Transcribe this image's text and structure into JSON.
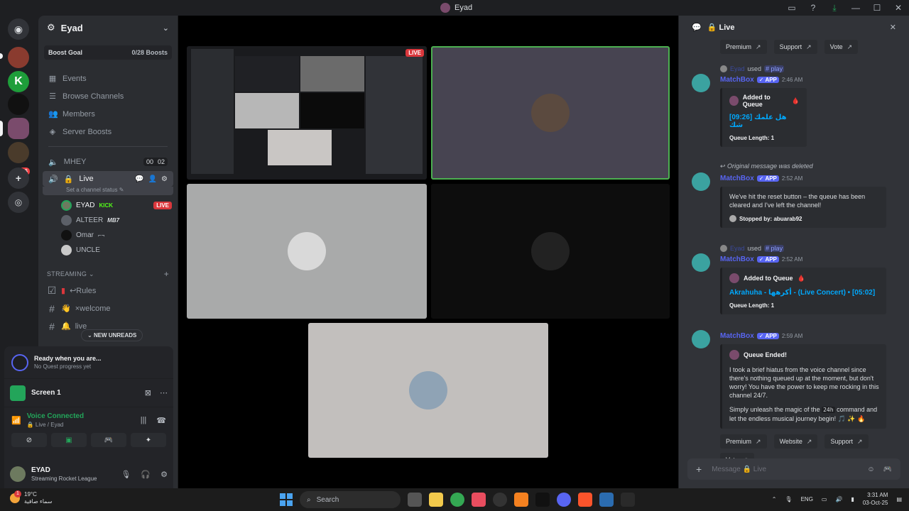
{
  "window": {
    "title": "Eyad"
  },
  "server": {
    "name": "Eyad",
    "boost_goal_label": "Boost Goal",
    "boost_count": "0/28 Boosts",
    "badge_count": "96"
  },
  "nav": [
    {
      "label": "Events",
      "icon": "calendar-icon"
    },
    {
      "label": "Browse Channels",
      "icon": "browse-icon"
    },
    {
      "label": "Members",
      "icon": "members-icon"
    },
    {
      "label": "Server Boosts",
      "icon": "boost-icon"
    }
  ],
  "voice_channels": {
    "mhey": {
      "name": "MHEY",
      "count_a": "00",
      "count_b": "02"
    },
    "live": {
      "name": "Live",
      "status": "Set a channel status"
    }
  },
  "voice_users": [
    {
      "name": "EYAD",
      "tag": "KICK",
      "live": "LIVE"
    },
    {
      "name": "ALTEER",
      "tag": "MB7"
    },
    {
      "name": "Omar",
      "tag": "⌐¬"
    },
    {
      "name": "UNCLE"
    }
  ],
  "category": {
    "name": "STREAMING"
  },
  "text_channels": [
    {
      "name": "↩Rules"
    },
    {
      "name": "×welcome"
    },
    {
      "name": "live"
    }
  ],
  "new_unreads": "NEW UNREADS",
  "quest": {
    "title": "Ready when you are...",
    "subtitle": "No Quest progress yet"
  },
  "screen": {
    "label": "Screen 1"
  },
  "voice_status": {
    "title": "Voice Connected",
    "channel": "Live / Eyad"
  },
  "profile": {
    "name": "EYAD",
    "status": "Streaming Rocket League"
  },
  "stage": {
    "live_badge": "LIVE"
  },
  "chat": {
    "header": "Live",
    "top_buttons": [
      "Premium",
      "Support",
      "Vote"
    ],
    "messages": [
      {
        "reply_user": "Eyad",
        "reply_text": "used",
        "command": "# play",
        "author": "MatchBox",
        "app": "APP",
        "time": "2:46 AM",
        "embed_title_line": "Added to Queue",
        "embed_link": "[09:26] هل علمك شك",
        "embed_footer": "Queue Length: 1"
      },
      {
        "deleted_note": "Original message was deleted",
        "author": "MatchBox",
        "app": "APP",
        "time": "2:52 AM",
        "embed_body": "We've hit the reset button – the queue has been cleared and I've left the channel!",
        "embed_footer": "Stopped by: abuarab92"
      },
      {
        "reply_user": "Eyad",
        "reply_text": "used",
        "command": "# play",
        "author": "MatchBox",
        "app": "APP",
        "time": "2:52 AM",
        "embed_title_line": "Added to Queue",
        "embed_link": "Akrahuha - أكرهها - (Live Concert) • [05:02]",
        "embed_footer": "Queue Length: 1"
      },
      {
        "author": "MatchBox",
        "app": "APP",
        "time": "2:59 AM",
        "embed_title_line": "Queue Ended!",
        "embed_body": "I took a brief hiatus from the voice channel since there's nothing queued up at the moment, but don't worry! You have the power to keep me rocking in this channel 24/7.",
        "embed_body2_pre": "Simply unleash the magic of the",
        "embed_body2_code": "24h",
        "embed_body2_post": "command and let the endless musical journey begin! 🎵 ✨ 🔥"
      }
    ],
    "bottom_buttons": [
      "Premium",
      "Website",
      "Support"
    ],
    "vote_button": "Vote",
    "composer_placeholder": "Message 🔒 Live"
  },
  "taskbar": {
    "weather_temp": "19°C",
    "weather_desc": "سماء صافية",
    "weather_badge": "1",
    "search_label": "Search",
    "lang": "ENG",
    "time": "3:31 AM",
    "date": "03-Oct-25"
  }
}
